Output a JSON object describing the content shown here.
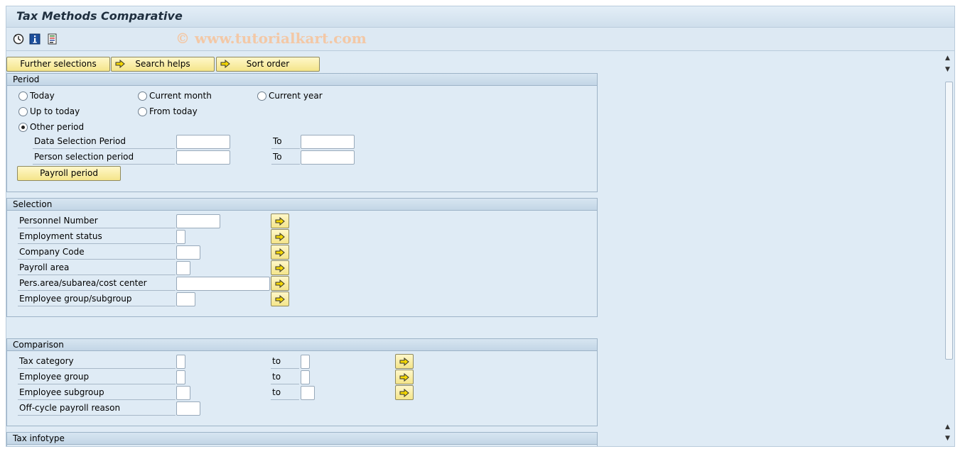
{
  "window": {
    "title": "Tax Methods Comparative"
  },
  "toolbar": {
    "icons": [
      "execute-icon",
      "info-icon",
      "variant-icon"
    ],
    "watermark": "© www.tutorialkart.com"
  },
  "top_buttons": {
    "further_selections": "Further selections",
    "search_helps": "Search helps",
    "sort_order": "Sort order"
  },
  "period": {
    "title": "Period",
    "options": {
      "today": "Today",
      "current_month": "Current month",
      "current_year": "Current year",
      "up_to_today": "Up to today",
      "from_today": "From today",
      "other_period": "Other period"
    },
    "selected": "other_period",
    "data_selection_label": "Data Selection Period",
    "data_selection_from": "",
    "data_selection_to": "",
    "person_selection_label": "Person selection period",
    "person_selection_from": "",
    "person_selection_to": "",
    "to_label": "To",
    "payroll_button": "Payroll period"
  },
  "selection": {
    "title": "Selection",
    "fields": {
      "personnel_number": {
        "label": "Personnel Number",
        "value": ""
      },
      "employment_status": {
        "label": "Employment status",
        "value": ""
      },
      "company_code": {
        "label": "Company Code",
        "value": ""
      },
      "payroll_area": {
        "label": "Payroll area",
        "value": ""
      },
      "pers_area": {
        "label": "Pers.area/subarea/cost center",
        "value": ""
      },
      "employee_group": {
        "label": "Employee group/subgroup",
        "value": ""
      }
    }
  },
  "comparison": {
    "title": "Comparison",
    "to_label": "to",
    "fields": {
      "tax_category": {
        "label": "Tax category",
        "from": "",
        "to": ""
      },
      "employee_group": {
        "label": "Employee group",
        "from": "",
        "to": ""
      },
      "employee_subgroup": {
        "label": "Employee subgroup",
        "from": "",
        "to": ""
      },
      "off_cycle": {
        "label": "Off-cycle payroll reason",
        "value": ""
      }
    }
  },
  "tax_infotype": {
    "title": "Tax infotype"
  },
  "colors": {
    "background": "#dfebf5",
    "button_yellow": "#f4e58a",
    "group_border": "#9db3c7"
  }
}
